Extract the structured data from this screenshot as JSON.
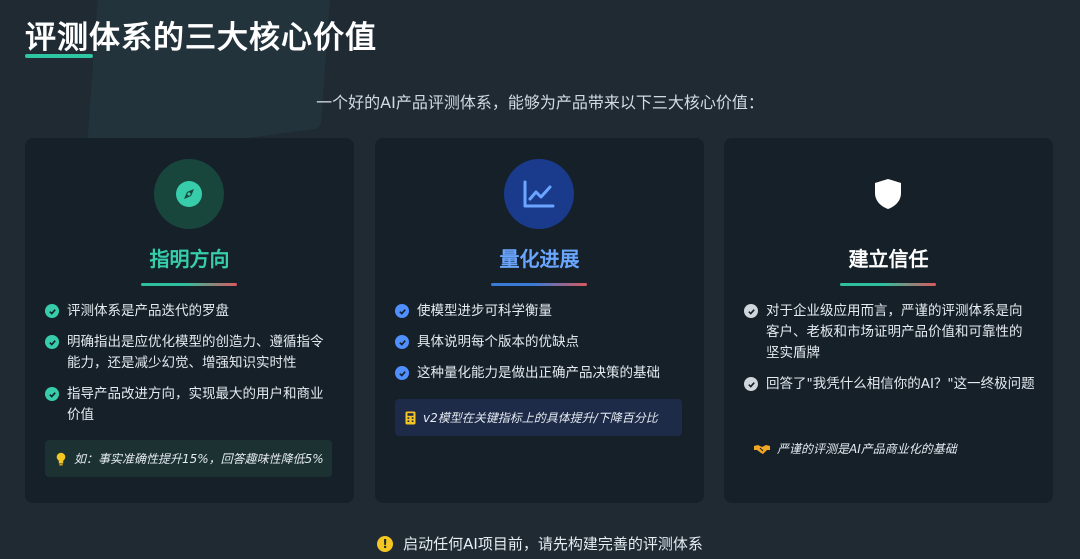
{
  "header": {
    "title": "评测体系的三大核心价值",
    "subtitle": "一个好的AI产品评测体系，能够为产品带来以下三大核心价值："
  },
  "colors": {
    "accent_teal": "#37cdaa",
    "accent_blue": "#4f8fff",
    "background": "#1f2a33",
    "card": "#152029",
    "warning": "#f3c623"
  },
  "cards": [
    {
      "icon": "compass-icon",
      "title": "指明方向",
      "bullets": [
        "评测体系是产品迭代的罗盘",
        "明确指出是应优化模型的创造力、遵循指令能力，还是减少幻觉、增强知识实时性",
        "指导产品改进方向，实现最大的用户和商业价值"
      ],
      "note_icon": "lightbulb-icon",
      "note": "如：事实准确性提升15%，回答趣味性降低5%"
    },
    {
      "icon": "chart-line-icon",
      "title": "量化进展",
      "bullets": [
        "使模型进步可科学衡量",
        "具体说明每个版本的优缺点",
        "这种量化能力是做出正确产品决策的基础"
      ],
      "note_icon": "calculator-icon",
      "note": "v2模型在关键指标上的具体提升/下降百分比"
    },
    {
      "icon": "shield-icon",
      "title": "建立信任",
      "bullets": [
        "对于企业级应用而言，严谨的评测体系是向客户、老板和市场证明产品价值和可靠性的坚实盾牌",
        "回答了\"我凭什么相信你的AI？\"这一终极问题"
      ],
      "note_icon": "handshake-icon",
      "note": "严谨的评测是AI产品商业化的基础"
    }
  ],
  "footer": {
    "icon": "warning-icon",
    "text": "启动任何AI项目前，请先构建完善的评测体系"
  }
}
